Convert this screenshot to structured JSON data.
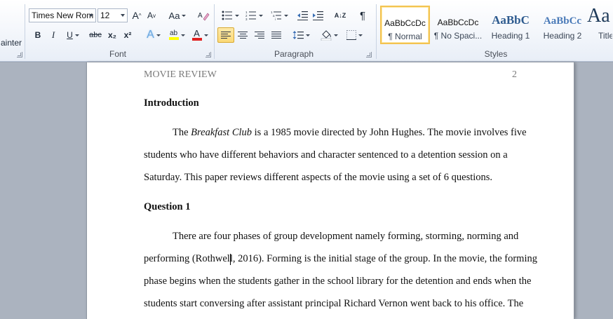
{
  "ribbon": {
    "clipboard": {
      "format_painter_label": "ainter"
    },
    "font": {
      "group_label": "Font",
      "font_name": "Times New Rom",
      "font_size": "12",
      "grow_glyph": "A",
      "shrink_glyph": "A",
      "change_case_glyph": "Aa",
      "bold": "B",
      "italic": "I",
      "underline": "U",
      "strikethrough": "abc",
      "subscript": "x₂",
      "superscript": "x²",
      "text_effects_glyph": "A",
      "highlight_glyph": "ab",
      "font_color_glyph": "A",
      "highlight_color": "#ffff00",
      "font_color": "#e02020"
    },
    "paragraph": {
      "group_label": "Paragraph",
      "sort_glyph": "A↓Z",
      "pilcrow": "¶"
    },
    "styles": {
      "group_label": "Styles",
      "items": [
        {
          "sample": "AaBbCcDc",
          "name": "¶ Normal",
          "selected": true
        },
        {
          "sample": "AaBbCcDc",
          "name": "¶ No Spaci...",
          "selected": false
        },
        {
          "sample": "AaBbC",
          "name": "Heading 1",
          "selected": false
        },
        {
          "sample": "AaBbCc",
          "name": "Heading 2",
          "selected": false
        },
        {
          "sample": "Aa",
          "name": "Title",
          "selected": false
        }
      ]
    }
  },
  "document": {
    "running_head": "MOVIE REVIEW",
    "page_number": "2",
    "intro_heading": "Introduction",
    "p1": {
      "l1_a": "The ",
      "l1_italic": "Breakfast Club",
      "l1_b": " is a 1985 movie directed by John Hughes. The movie involves five",
      "l2": "students who have different behaviors and character sentenced to a detention session on a",
      "l3": "Saturday. This paper reviews different aspects of the movie using a set of 6 questions."
    },
    "q1_heading": "Question 1",
    "p2": {
      "l1": "There are four phases of group development namely forming, storming, norming and",
      "l2": "performing (Rothwell, 2016). Forming is the initial stage of the group. In the movie, the forming",
      "l3": "phase begins when the students gather in the school library for the detention and ends when the",
      "l4": "students start conversing after assistant principal Richard Vernon went back to his office. The"
    }
  }
}
